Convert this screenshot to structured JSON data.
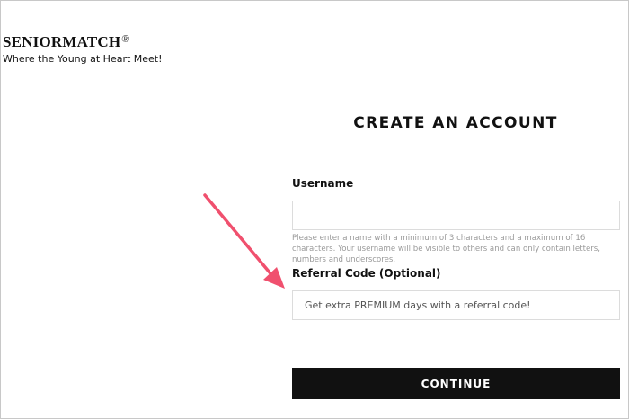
{
  "brand": {
    "name": "SENIORMATCH",
    "registered": "®",
    "tagline": "Where the Young at Heart Meet!"
  },
  "form": {
    "title": "CREATE AN ACCOUNT",
    "username": {
      "label": "Username",
      "value": "",
      "help": "Please enter a name with a minimum of 3 characters and a maximum of 16 characters. Your username will be visible to others and can only contain letters, numbers and underscores."
    },
    "referral": {
      "label": "Referral Code (Optional)",
      "value": "",
      "placeholder": "Get extra PREMIUM days with a referral code!"
    },
    "continue_label": "CONTINUE"
  },
  "annotation": {
    "arrow_color": "#f0506e"
  }
}
